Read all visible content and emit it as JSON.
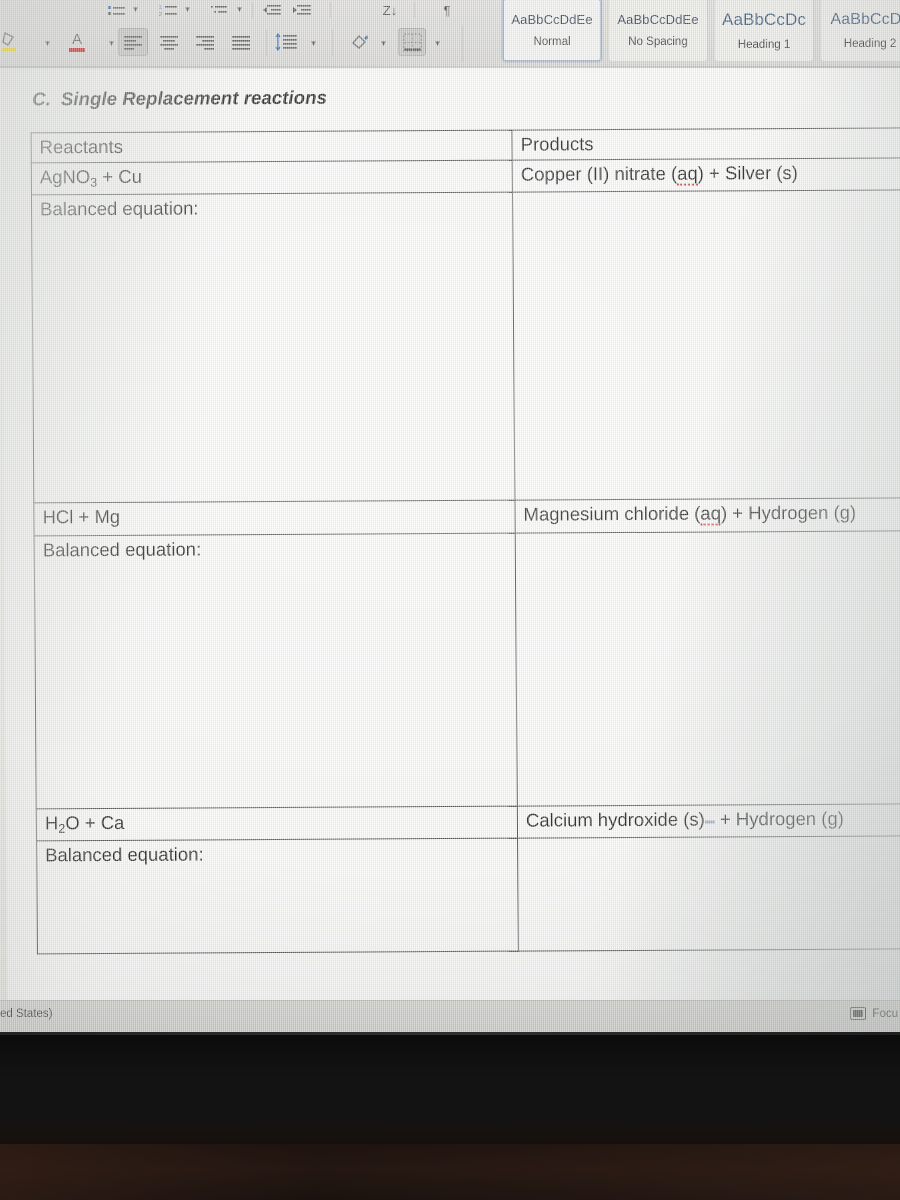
{
  "ribbon": {
    "top_row_icons": [
      {
        "name": "bullets-icon",
        "glyph": "bullets"
      },
      {
        "name": "numbering-icon",
        "glyph": "numbering"
      },
      {
        "name": "multilevel-list-icon",
        "glyph": "multilevel"
      },
      {
        "name": "decrease-indent-icon",
        "glyph": "indent-dec"
      },
      {
        "name": "increase-indent-icon",
        "glyph": "indent-inc"
      },
      {
        "name": "sort-icon",
        "label": "Z↓"
      },
      {
        "name": "show-formatting-marks-icon",
        "label": "¶"
      }
    ],
    "main_row_icons": [
      {
        "name": "text-highlight-color-icon",
        "color": "#f2d600"
      },
      {
        "name": "font-color-icon",
        "label": "A",
        "color": "#cc2222"
      },
      {
        "name": "align-left-icon",
        "selected": true
      },
      {
        "name": "align-center-icon",
        "selected": false
      },
      {
        "name": "align-right-icon",
        "selected": false
      },
      {
        "name": "justify-icon",
        "selected": false
      },
      {
        "name": "line-and-paragraph-spacing-icon",
        "color": "#2f6bb5"
      },
      {
        "name": "shading-icon"
      },
      {
        "name": "borders-icon",
        "selected": true
      }
    ],
    "styles": [
      {
        "preview": "AaBbCcDdEe",
        "label": "Normal",
        "active": true,
        "preview_size": 13
      },
      {
        "preview": "AaBbCcDdEe",
        "label": "No Spacing",
        "active": false,
        "preview_size": 13
      },
      {
        "preview": "AaBbCcDc",
        "label": "Heading 1",
        "active": false,
        "preview_size": 17
      },
      {
        "preview": "AaBbCcDc",
        "label": "Heading 2",
        "active": false,
        "preview_size": 16
      }
    ]
  },
  "document": {
    "heading": {
      "label": "C.",
      "text": "Single Replacement reactions"
    },
    "table": {
      "headers": {
        "reactants": "Reactants",
        "products": "Products"
      },
      "balanced_label": "Balanced equation:",
      "rows": [
        {
          "reactant_formula": "AgNO",
          "reactant_sub": "3",
          "reactant_tail": " + Cu",
          "product_pre": "Copper (II) nitrate (",
          "product_misspelled": "aq",
          "product_post": ") + Silver (s)",
          "balanced_answer": ""
        },
        {
          "reactant_formula": "HCl + Mg",
          "reactant_sub": "",
          "reactant_tail": "",
          "product_pre": "Magnesium chloride (",
          "product_misspelled": "aq",
          "product_post": ") + Hydrogen (g)",
          "balanced_answer": ""
        },
        {
          "reactant_formula": "H",
          "reactant_sub": "2",
          "reactant_tail": "O + Ca",
          "product_pre": "Calcium hydroxide (s)",
          "product_misspelled": "",
          "product_post": " + Hydrogen (g)",
          "balanced_answer": ""
        }
      ]
    }
  },
  "status_bar": {
    "language": "ed States)",
    "focus_label": "Focu"
  }
}
